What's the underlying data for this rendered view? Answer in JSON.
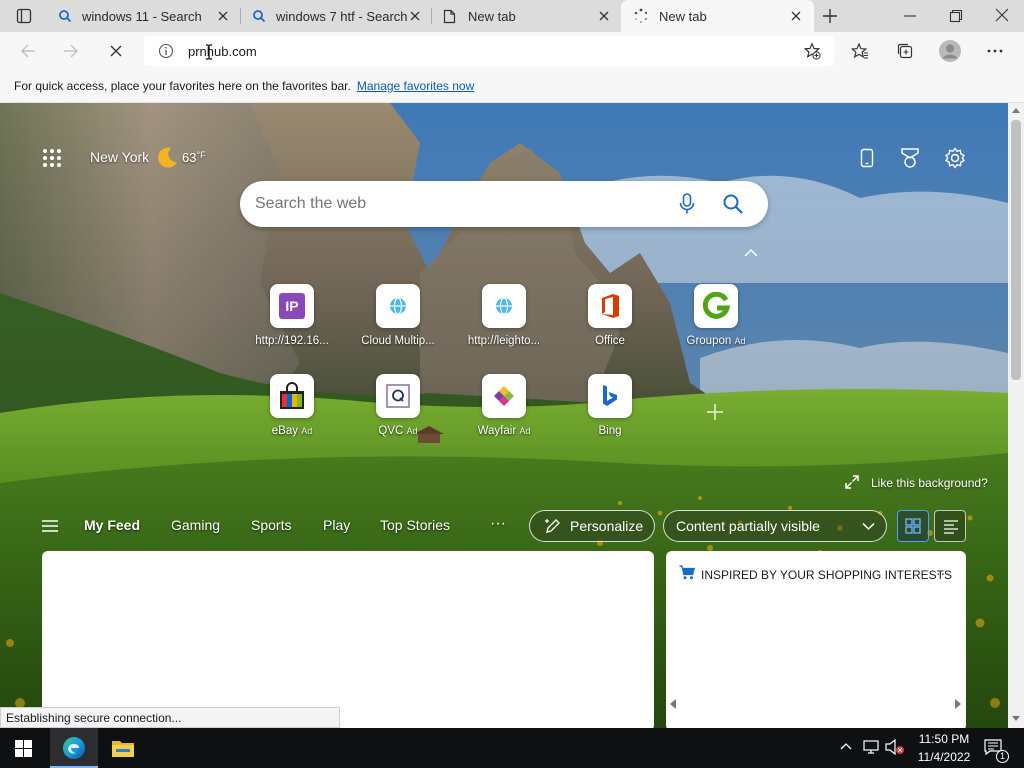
{
  "tabs": [
    {
      "label": "windows 11 - Search",
      "icon": "search-icon"
    },
    {
      "label": "windows 7 htf - Search",
      "icon": "search-icon"
    },
    {
      "label": "New tab",
      "icon": "page-icon"
    },
    {
      "label": "New tab",
      "icon": "loading-icon"
    }
  ],
  "address": {
    "url": "prnhub.com"
  },
  "favbar": {
    "text": "For quick access, place your favorites here on the favorites bar.",
    "link": "Manage favorites now"
  },
  "weather": {
    "city": "New York",
    "temp": "63",
    "unit": "°F"
  },
  "search": {
    "placeholder": "Search the web"
  },
  "quicklinks": [
    {
      "label": "http://192.16...",
      "ad": "",
      "icon": "ip-icon"
    },
    {
      "label": "Cloud Multip...",
      "ad": "",
      "icon": "globe-icon"
    },
    {
      "label": "http://leighto...",
      "ad": "",
      "icon": "globe-icon"
    },
    {
      "label": "Office",
      "ad": "",
      "icon": "office-icon"
    },
    {
      "label": "Groupon",
      "ad": "Ad",
      "icon": "groupon-icon"
    },
    {
      "label": "eBay",
      "ad": "Ad",
      "icon": "ebay-icon"
    },
    {
      "label": "QVC",
      "ad": "Ad",
      "icon": "qvc-icon"
    },
    {
      "label": "Wayfair",
      "ad": "Ad",
      "icon": "wayfair-icon"
    },
    {
      "label": "Bing",
      "ad": "",
      "icon": "bing-icon"
    }
  ],
  "like_bg": "Like this background?",
  "feed_nav": {
    "items": [
      "My Feed",
      "Gaming",
      "Sports",
      "Play",
      "Top Stories"
    ],
    "more": "···",
    "personalize": "Personalize",
    "visibility": "Content partially visible"
  },
  "shopping_card": {
    "title": "INSPIRED BY YOUR SHOPPING INTERESTS",
    "more": "···"
  },
  "status": "Establishing secure connection...",
  "clock": {
    "time": "11:50 PM",
    "date": "11/4/2022"
  },
  "notifications": {
    "count": "1"
  },
  "colors": {
    "accent": "#0b5ab8",
    "office": "#d83b01",
    "groupon": "#53a318",
    "taskbar": "#0f1012"
  }
}
